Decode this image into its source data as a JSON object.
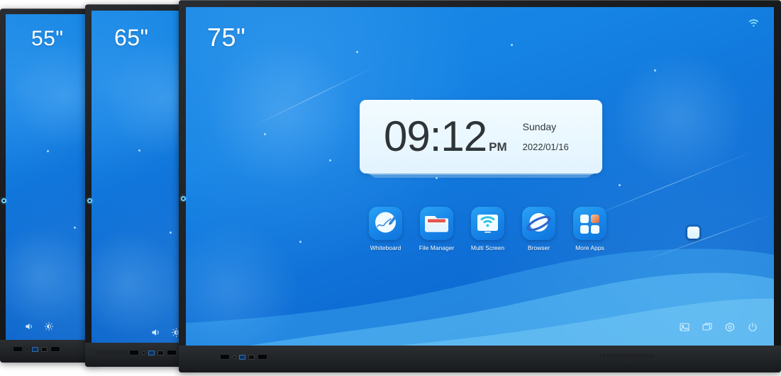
{
  "scene": {
    "description": "Three interactive flat panel displays of different sizes shown side by side, the largest showing an Android-style home screen",
    "background_color": "#ffffff"
  },
  "panels": [
    {
      "size_label": "55\"",
      "name": "panel-55"
    },
    {
      "size_label": "65\"",
      "name": "panel-65"
    },
    {
      "size_label": "75\"",
      "name": "panel-75"
    }
  ],
  "panel_controls": {
    "volume_icon": "speaker-icon",
    "brightness_icon": "brightness-icon"
  },
  "statusbar": {
    "wifi_icon": "wifi-icon"
  },
  "clock_widget": {
    "time": "09:12",
    "ampm": "PM",
    "weekday": "Sunday",
    "date": "2022/01/16"
  },
  "dock": {
    "apps": [
      {
        "label": "Whiteboard",
        "icon": "whiteboard-icon"
      },
      {
        "label": "File Manager",
        "icon": "folder-icon"
      },
      {
        "label": "Multi Screen",
        "icon": "wifi-cast-icon"
      },
      {
        "label": "Browser",
        "icon": "globe-icon"
      },
      {
        "label": "More Apps",
        "icon": "grid-apps-icon"
      }
    ]
  },
  "side_toggle": {
    "name": "side-menu-toggle",
    "icon": "rounded-square-icon"
  },
  "tray": {
    "items": [
      {
        "name": "gallery",
        "icon": "image-icon"
      },
      {
        "name": "screen-share",
        "icon": "screen-cast-icon"
      },
      {
        "name": "settings",
        "icon": "gear-icon"
      },
      {
        "name": "power",
        "icon": "power-icon"
      }
    ]
  },
  "colors": {
    "screen_blue": "#1583e4",
    "accent_cyan": "#3fd0f5",
    "bezel_dark": "#1b1d20",
    "card_light": "#eaf7ff",
    "folder_red": "#e2564f",
    "more_apps_orange": "#e88a4e"
  }
}
